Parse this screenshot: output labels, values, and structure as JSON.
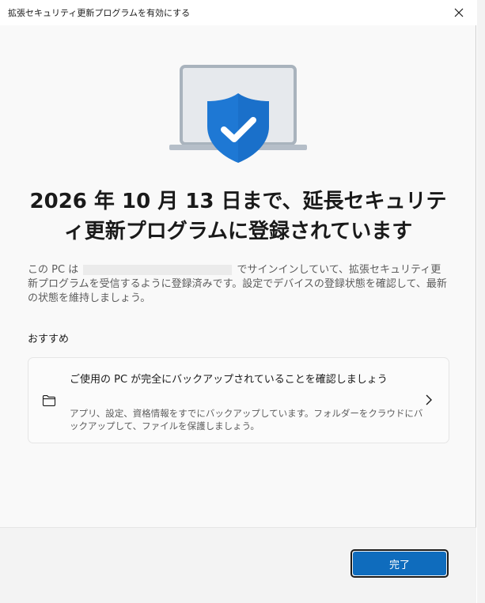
{
  "window": {
    "title": "拡張セキュリティ更新プログラムを有効にする"
  },
  "heading": "2026 年 10 月 13 日まで、延長セキュリティ更新プログラムに登録されています",
  "description": {
    "part1": "この PC は",
    "part2": "でサインインしていて、拡張セキュリティ更新プログラムを受信するように登録済みです。設定でデバイスの登録状態を確認して、最新の状態を維持しましょう。"
  },
  "recommended": {
    "label": "おすすめ",
    "card": {
      "icon": "folder-icon",
      "title": "ご使用の PC が完全にバックアップされていることを確認しましょう",
      "description": "アプリ、設定、資格情報をすでにバックアップしています。フォルダーをクラウドにバックアップして、ファイルを保護しましょう。"
    }
  },
  "footer": {
    "done_label": "完了"
  },
  "colors": {
    "accent": "#0f6cbd",
    "shield": "#1e78d4"
  }
}
